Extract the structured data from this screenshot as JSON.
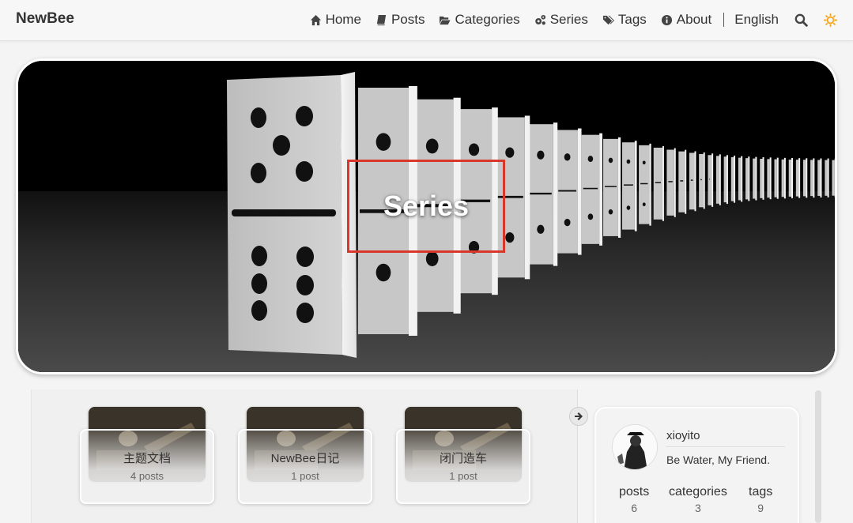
{
  "header": {
    "brand": "NewBee",
    "nav": [
      {
        "label": "Home",
        "icon": "home-icon"
      },
      {
        "label": "Posts",
        "icon": "book-icon"
      },
      {
        "label": "Categories",
        "icon": "folder-open-icon"
      },
      {
        "label": "Series",
        "icon": "cogs-icon"
      },
      {
        "label": "Tags",
        "icon": "tags-icon"
      },
      {
        "label": "About",
        "icon": "info-circle-icon"
      }
    ],
    "language": "English",
    "search_icon": "search-icon",
    "theme_icon": "sun-icon"
  },
  "hero": {
    "title": "Series"
  },
  "series": [
    {
      "name": "主题文档",
      "count": "4 posts"
    },
    {
      "name": "NewBee日记",
      "count": "1 post"
    },
    {
      "name": "闭门造车",
      "count": "1 post"
    }
  ],
  "sidebar": {
    "toggle_icon": "arrow-right-icon",
    "author": {
      "name": "xioyito",
      "bio": "Be Water, My Friend."
    },
    "stats": [
      {
        "label": "posts",
        "value": "6"
      },
      {
        "label": "categories",
        "value": "3"
      },
      {
        "label": "tags",
        "value": "9"
      }
    ]
  },
  "colors": {
    "highlight_border": "#d9372b",
    "sun": "#f5a623"
  }
}
